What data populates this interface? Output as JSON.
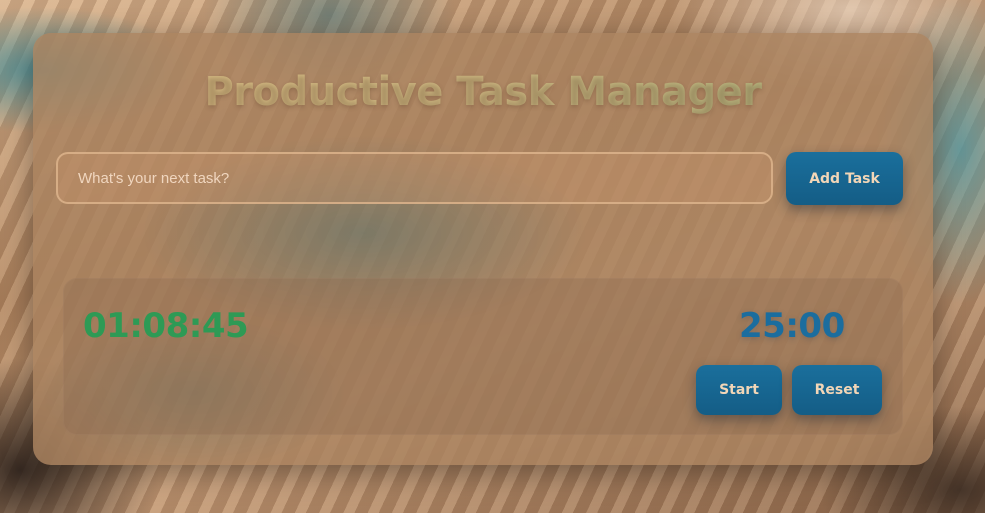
{
  "app": {
    "title": "Productive Task Manager"
  },
  "task_entry": {
    "placeholder": "What's your next task?",
    "value": "",
    "add_button_label": "Add Task"
  },
  "timers": {
    "elapsed_time": "01:08:45",
    "pomodoro_time": "25:00",
    "start_label": "Start",
    "reset_label": "Reset"
  },
  "colors": {
    "accent_button": "#1a6f9c",
    "elapsed_color": "#2e9a55",
    "pomodoro_color": "#1b6d9e",
    "title_gradient_start": "#d6b880",
    "title_gradient_end": "#a9b07a"
  }
}
